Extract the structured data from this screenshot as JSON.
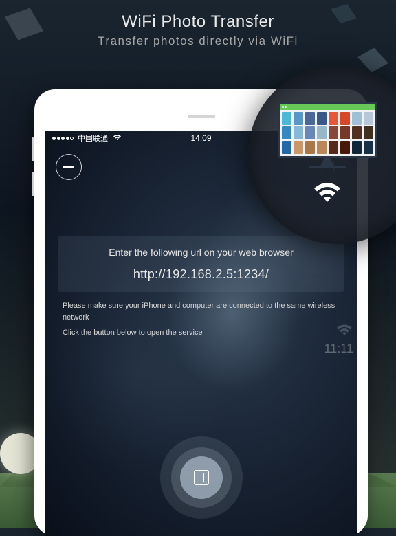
{
  "header": {
    "title": "WiFi Photo Transfer",
    "subtitle": "Transfer photos directly via WiFi"
  },
  "statusBar": {
    "carrier": "中国联通",
    "time": "14:09"
  },
  "overlay": {
    "time": "11:11"
  },
  "contentBox": {
    "prompt": "Enter the following url on your web browser",
    "url": "http://192.168.2.5:1234/"
  },
  "instructions": {
    "line1": "Please make sure  your iPhone and computer are connected to the same wireless network",
    "line2": "Click the button below to open the service"
  },
  "icons": {
    "menu": "menu-icon",
    "add": "add-icon",
    "wifi": "wifi-icon",
    "pause": "pause-icon"
  },
  "thumbs": [
    [
      "#4bb8d8",
      "#3588c0",
      "#2568a8"
    ],
    [
      "#5898c8",
      "#88b8d8",
      "#c89868"
    ],
    [
      "#486898",
      "#6888b8",
      "#a87848"
    ],
    [
      "#385888",
      "#98b8c8",
      "#b88858"
    ],
    [
      "#e85838",
      "#884838",
      "#582818"
    ],
    [
      "#d84828",
      "#783828",
      "#481808"
    ],
    [
      "#a0c0d8",
      "#503020",
      "#102838"
    ],
    [
      "#b8c8d8",
      "#403020",
      "#183048"
    ]
  ]
}
